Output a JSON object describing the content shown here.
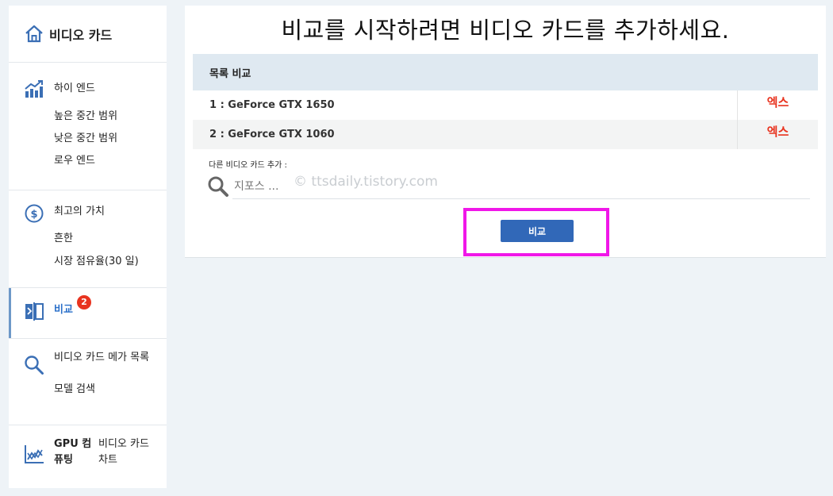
{
  "sidebar": {
    "brand": "비디오 카드",
    "high_end": {
      "title": "하이 엔드",
      "items": [
        "높은 중간 범위",
        "낮은 중간 범위",
        "로우 엔드"
      ]
    },
    "value": {
      "title": "최고의 가치",
      "items": [
        "흔한",
        "시장 점유율(30 일)"
      ]
    },
    "compare": {
      "title": "비교",
      "badge": "2"
    },
    "mega": {
      "title": "비디오 카드 메가 목록",
      "items": [
        "모델 검색"
      ]
    },
    "gpu": {
      "title": "GPU 컴퓨팅",
      "title2": "비디오 카드 차트"
    }
  },
  "main": {
    "headline": "비교를 시작하려면 비디오 카드를 추가하세요.",
    "table_header": "목록 비교",
    "rows": [
      {
        "name": "1 : GeForce GTX 1650",
        "remove": "엑스"
      },
      {
        "name": "2 : GeForce GTX 1060",
        "remove": "엑스"
      }
    ],
    "add_label": "다른 비디오 카드 추가 :",
    "search_placeholder": "지포스 ...",
    "watermark": "© ttsdaily.tistory.com",
    "compare_button": "비교"
  },
  "colors": {
    "accent": "#3168b8",
    "remove": "#e8331f",
    "highlight": "#f017e8",
    "badge": "#e8331f"
  }
}
